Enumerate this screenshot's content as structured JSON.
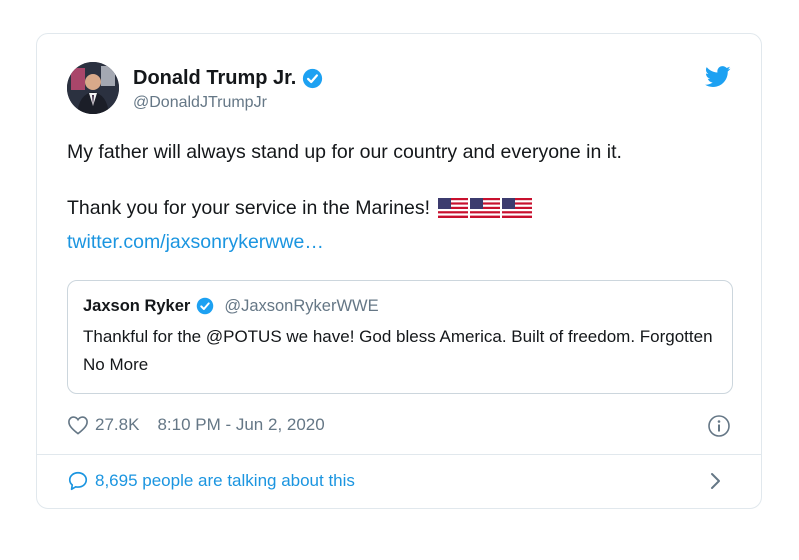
{
  "tweet": {
    "display_name": "Donald Trump Jr.",
    "handle": "@DonaldJTrumpJr",
    "line1": "My father will always stand up for our country and everyone in it.",
    "line2": "Thank you for your service in the Marines!",
    "link": "twitter.com/jaxsonrykerwwe…",
    "likes": "27.8K",
    "timestamp": "8:10 PM - Jun 2, 2020",
    "footer": "8,695 people are talking about this"
  },
  "quote": {
    "display_name": "Jaxson Ryker",
    "handle": "@JaxsonRykerWWE",
    "text": "Thankful for the @POTUS we have! God bless America. Built of freedom. Forgotten No More"
  },
  "icons": {
    "verified": "verified-badge-icon",
    "bird": "twitter-bird-icon",
    "heart": "heart-icon",
    "info": "info-icon",
    "comment": "comment-bubble-icon",
    "chevron": "chevron-right-icon",
    "flag": "us-flag-emoji"
  },
  "colors": {
    "accent": "#1da1f2",
    "link": "#1b95e0",
    "muted": "#657786",
    "border": "#e1e8ed"
  }
}
